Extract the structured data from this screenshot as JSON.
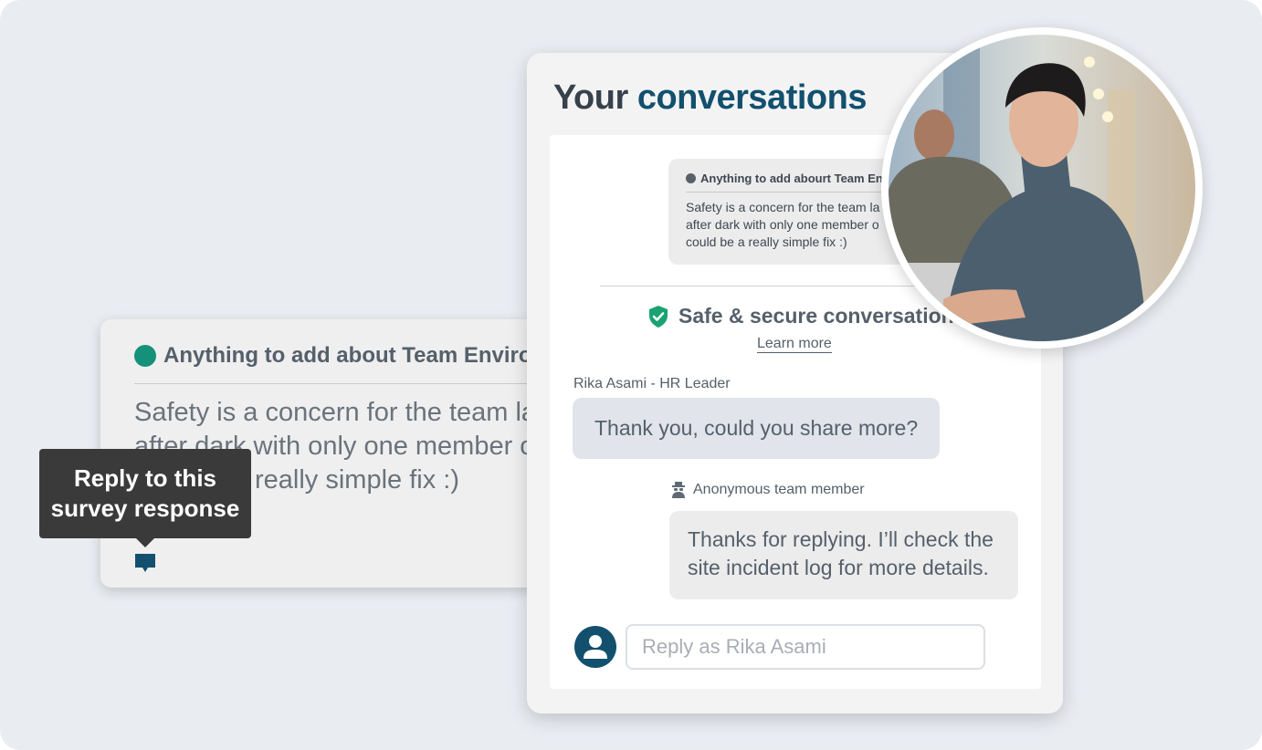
{
  "survey_card": {
    "question": "Anything to add about Team Environ",
    "answer_lines": [
      "Safety is a concern for the team lat",
      "after dark with only one member o",
      "really simple fix :)"
    ]
  },
  "tooltip": {
    "line1": "Reply to this",
    "line2": "survey response"
  },
  "conversations": {
    "title_part1": "Your",
    "title_part2": "conversations",
    "quote_question": "Anything to add abourt Team Enviro",
    "quote_answer_lines": [
      "Safety is a concern for the team la",
      "after dark with only one member o",
      "could be a really simple fix :)"
    ],
    "secure_label": "Safe & secure conversations",
    "learn_more": "Learn more",
    "messages": [
      {
        "sender": "Rika Asami - HR Leader",
        "lines": [
          "Thank you, could you share more?"
        ]
      },
      {
        "sender": "Anonymous team member",
        "lines": [
          "Thanks for replying. I’ll check the",
          "site incident log for more details."
        ]
      }
    ],
    "reply_placeholder": "Reply as Rika Asami"
  },
  "colors": {
    "accent": "#12506e",
    "green": "#159179",
    "text": "#55606b",
    "background": "#e9edf2"
  },
  "icons": {
    "reply": "chat-bubble-icon",
    "secure": "shield-check-icon",
    "anonymous": "anonymous-user-icon",
    "avatar": "user-avatar-icon"
  }
}
